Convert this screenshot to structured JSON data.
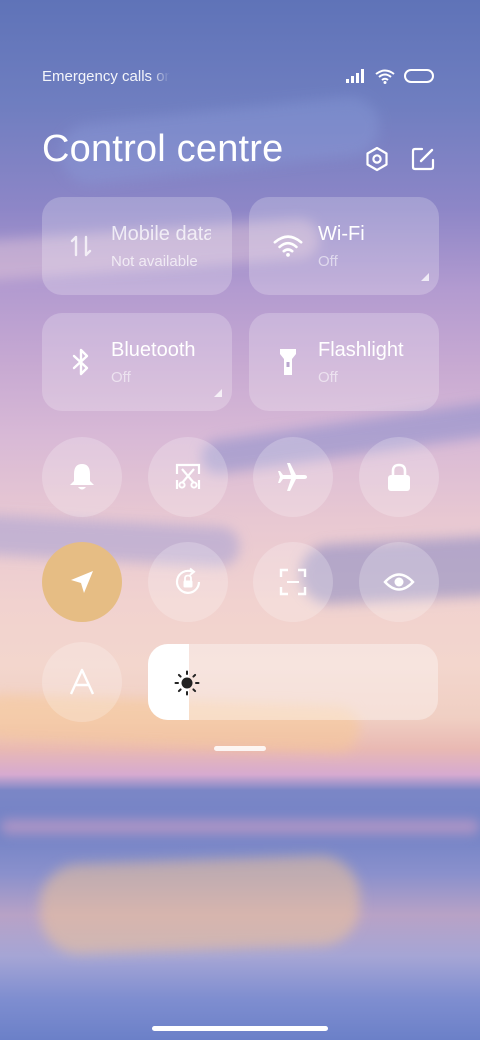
{
  "status_bar": {
    "carrier_text": "Emergency calls only",
    "icons": [
      "signal-icon",
      "wifi-icon",
      "battery-icon"
    ]
  },
  "header": {
    "title": "Control centre",
    "icons": [
      "settings-icon",
      "edit-icon"
    ]
  },
  "tiles": {
    "mobile_data": {
      "label": "Mobile data",
      "status": "Not available",
      "icon": "data-arrows-icon"
    },
    "wifi": {
      "label": "Wi-Fi",
      "status": "Off",
      "icon": "wifi-icon"
    },
    "bluetooth": {
      "label": "Bluetooth",
      "status": "Off",
      "icon": "bluetooth-icon"
    },
    "flashlight": {
      "label": "Flashlight",
      "status": "Off",
      "icon": "flashlight-icon"
    }
  },
  "toggles": [
    {
      "name": "ringer",
      "icon": "bell-icon",
      "active": false
    },
    {
      "name": "screenshot",
      "icon": "scissors-icon",
      "active": false
    },
    {
      "name": "airplane-mode",
      "icon": "airplane-icon",
      "active": false
    },
    {
      "name": "lock-screen",
      "icon": "lock-icon",
      "active": false
    },
    {
      "name": "location",
      "icon": "location-arrow-icon",
      "active": true
    },
    {
      "name": "rotation-lock",
      "icon": "rotation-lock-icon",
      "active": false
    },
    {
      "name": "scanner",
      "icon": "scan-icon",
      "active": false
    },
    {
      "name": "reading-mode",
      "icon": "eye-icon",
      "active": false
    },
    {
      "name": "auto-brightness",
      "icon": "auto-a-icon",
      "active": false
    }
  ],
  "brightness": {
    "level": 0.14,
    "icon": "sun-icon"
  },
  "colors": {
    "active_toggle": "#e6bd84"
  }
}
